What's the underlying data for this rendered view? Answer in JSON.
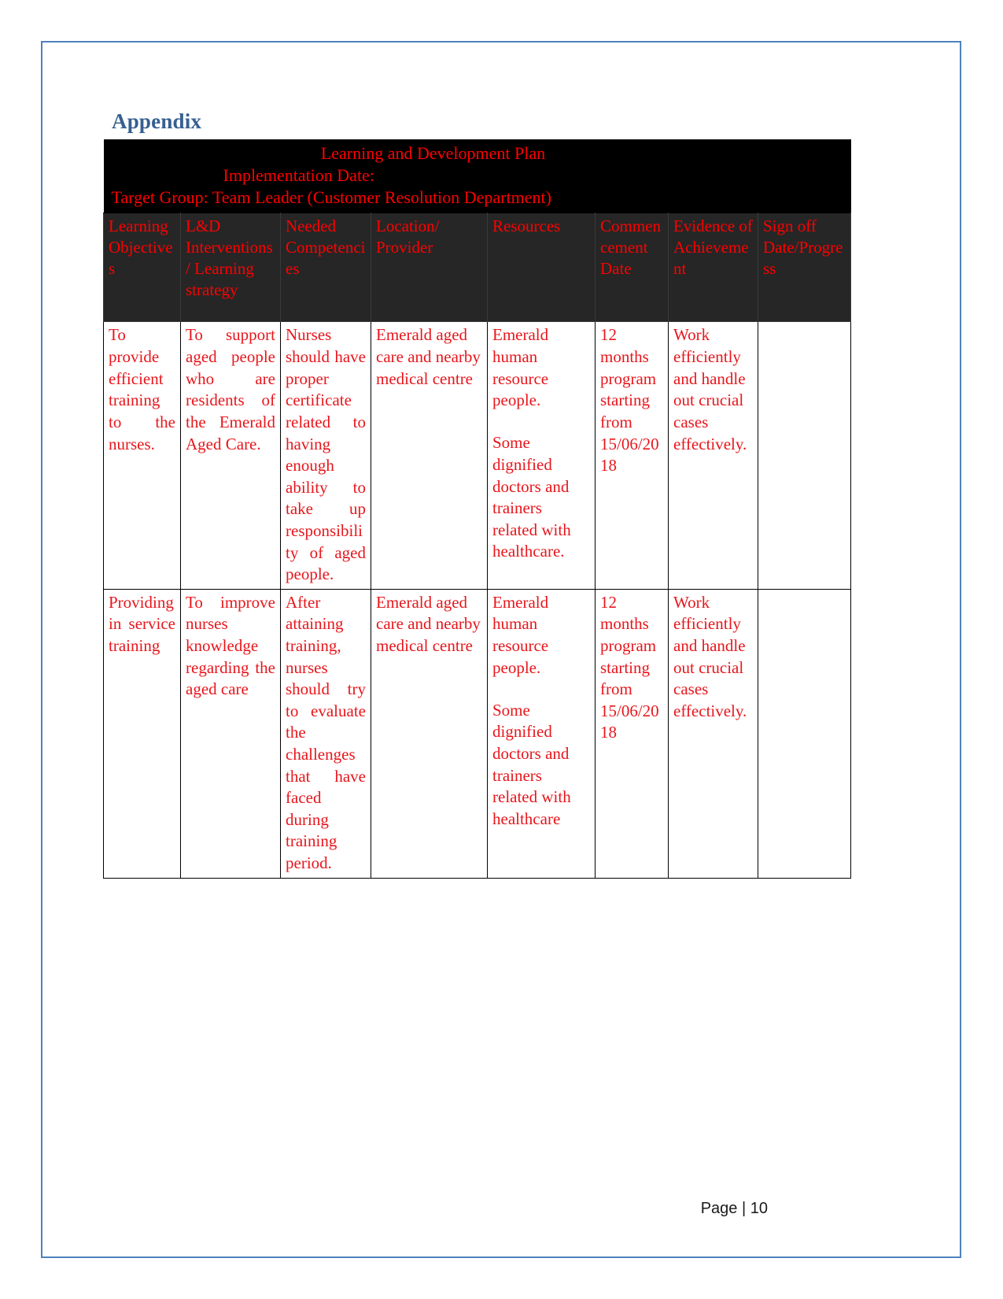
{
  "page": {
    "heading": "Appendix",
    "footer_label": "Page",
    "footer_separator": "|",
    "footer_number": "10",
    "border_color": "#4f81bd",
    "heading_color": "#365f91",
    "table_text_color": "#e8161c",
    "title_band_bg": "#000000",
    "header_row_bg": "#262626"
  },
  "table": {
    "title_band": {
      "plan_title": "Learning and Development Plan",
      "implementation_date": "Implementation Date:",
      "target_group": "Target Group:  Team Leader (Customer Resolution Department)"
    },
    "columns": [
      "Learning Objectives",
      "L&D Interventions/ Learning strategy",
      "Needed Competencies",
      "Location/ Provider",
      "Resources",
      "Commencement Date",
      "Evidence of Achievement",
      "Sign off Date/Progress"
    ],
    "rows": [
      {
        "learning_objectives": "To provide efficient training to the nurses.",
        "ld_interventions": "To support aged people who are residents of the Emerald Aged Care.",
        "needed_competencies": "Nurses should have proper certificate related to having enough ability to take up responsibility of aged people.",
        "location_provider": "Emerald aged care and nearby medical centre",
        "resources": [
          "Emerald human resource people.",
          "Some dignified doctors and trainers related with healthcare."
        ],
        "commencement_date": "12 months program starting from 15/06/2018",
        "evidence_of_achievement": "Work efficiently and handle out crucial cases effectively.",
        "sign_off": ""
      },
      {
        "learning_objectives": "Providing in service training",
        "ld_interventions": "To improve nurses knowledge regarding the aged care",
        "needed_competencies": "After attaining training, nurses should try to evaluate the challenges that have faced during training period.",
        "location_provider": "Emerald aged care and nearby medical centre",
        "resources": [
          "Emerald human resource people.",
          "Some dignified doctors and trainers related with healthcare"
        ],
        "commencement_date": "12 months program starting from 15/06/2018",
        "evidence_of_achievement": "Work efficiently and handle out crucial cases effectively.",
        "sign_off": ""
      }
    ]
  }
}
